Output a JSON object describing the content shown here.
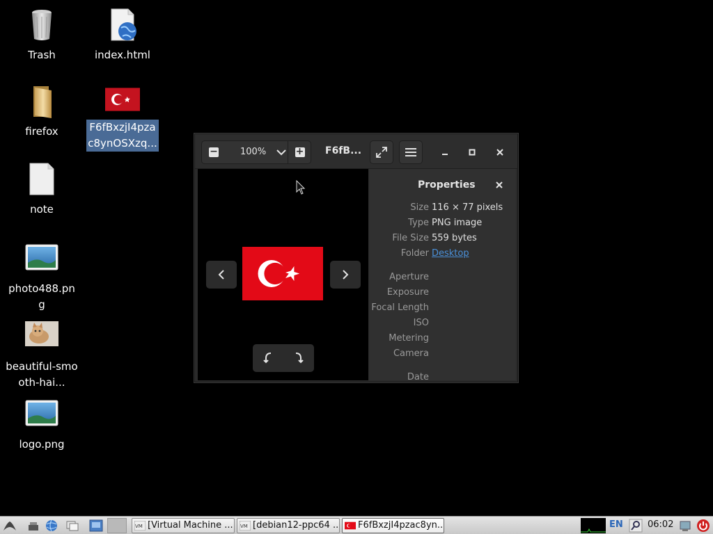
{
  "desktop": {
    "icons": [
      {
        "label": "Trash"
      },
      {
        "label": "index.html"
      },
      {
        "label": "firefox"
      },
      {
        "label": "F6fBxzjI4pzac8ynOSXzq..."
      },
      {
        "label": "note"
      },
      {
        "label": "photo488.png"
      },
      {
        "label": "beautiful-smooth-hai..."
      },
      {
        "label": "logo.png"
      }
    ]
  },
  "viewer": {
    "zoom_level": "100%",
    "title": "F6fB...",
    "properties": {
      "heading": "Properties",
      "rows": [
        {
          "key": "Size",
          "value": "116 × 77 pixels"
        },
        {
          "key": "Type",
          "value": "PNG image"
        },
        {
          "key": "File Size",
          "value": "559 bytes"
        },
        {
          "key": "Folder",
          "value": "Desktop"
        },
        {
          "key": "Aperture",
          "value": ""
        },
        {
          "key": "Exposure",
          "value": ""
        },
        {
          "key": "Focal Length",
          "value": ""
        },
        {
          "key": "ISO",
          "value": ""
        },
        {
          "key": "Metering",
          "value": ""
        },
        {
          "key": "Camera",
          "value": ""
        },
        {
          "key": "Date",
          "value": ""
        }
      ]
    }
  },
  "taskbar": {
    "tasks": [
      {
        "label": "[Virtual Machine ..."
      },
      {
        "label": "[debian12-ppc64 ..."
      },
      {
        "label": "F6fBxzjI4pzac8yn..."
      }
    ],
    "language": "EN",
    "clock": "06:02"
  },
  "colors": {
    "flag_red": "#e30a17",
    "link_blue": "#4a90d9",
    "selection": "#4a6b96"
  }
}
